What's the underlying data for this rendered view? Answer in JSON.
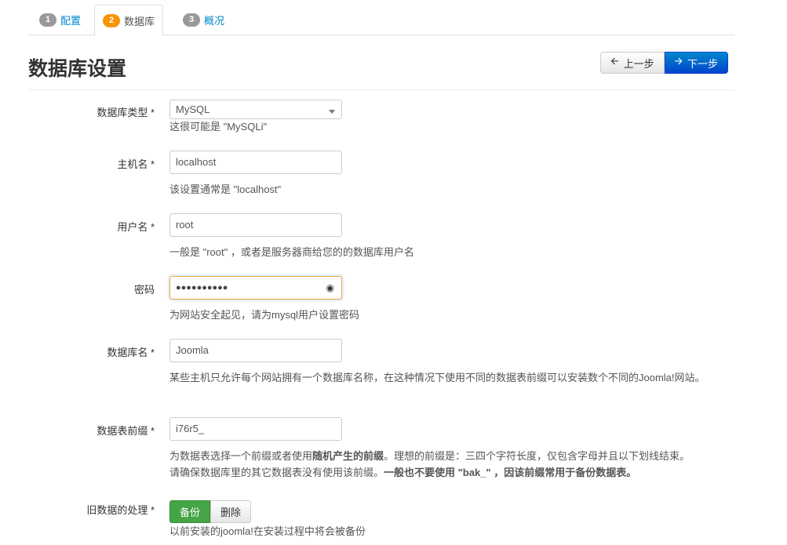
{
  "tabs": [
    {
      "num": "1",
      "label": "配置"
    },
    {
      "num": "2",
      "label": "数据库"
    },
    {
      "num": "3",
      "label": "概况"
    }
  ],
  "title": "数据库设置",
  "buttons": {
    "prev": "上一步",
    "next": "下一步"
  },
  "fields": {
    "db_type": {
      "label": "数据库类型 *",
      "value": "MySQL",
      "help": "这很可能是 \"MySQLi\""
    },
    "host": {
      "label": "主机名 *",
      "value": "localhost",
      "help": "该设置通常是 \"localhost\""
    },
    "user": {
      "label": "用户名 *",
      "value": "root",
      "help": "一般是 \"root\" ，或者是服务器商给您的的数据库用户名"
    },
    "password": {
      "label": "密码",
      "value": "●●●●●●●●●●",
      "help": "为网站安全起见，请为mysql用户设置密码"
    },
    "db_name": {
      "label": "数据库名 *",
      "value": "Joomla",
      "help": "某些主机只允许每个网站拥有一个数据库名称，在这种情况下使用不同的数据表前缀可以安装数个不同的Joomla!网站。"
    },
    "prefix": {
      "label": "数据表前缀 *",
      "value": "i76r5_",
      "help_1": "为数据表选择一个前缀或者使用",
      "help_1b": "随机产生的前缀",
      "help_1c": "。理想的前缀是：三四个字符长度，仅包含字母并且以下划线结束。",
      "help_2": "请确保数据库里的其它数据表没有使用该前缀。",
      "help_2b": "一般也不要使用 \"bak_\" ，因该前缀常用于备份数据表。"
    },
    "old_data": {
      "label": "旧数据的处理 *",
      "backup": "备份",
      "delete": "删除",
      "help": "以前安装的joomla!在安装过程中将会被备份"
    }
  }
}
